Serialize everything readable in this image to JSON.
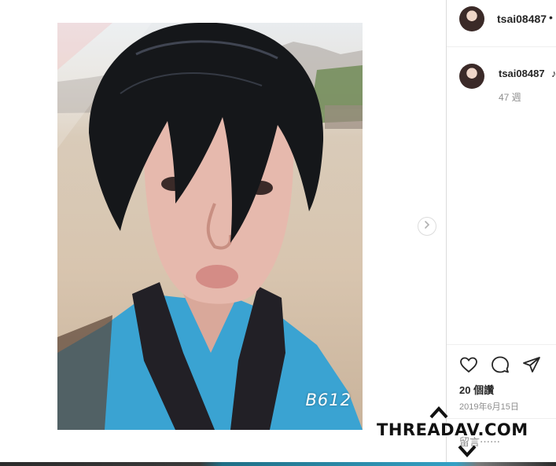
{
  "post": {
    "photo_label": "B612",
    "next_icon": "chevron-right-icon"
  },
  "sidebar": {
    "username": "tsai08487",
    "dot": "•",
    "comment": {
      "username": "tsai08487",
      "text_fragment": "♪",
      "time": "47 週"
    },
    "actions": [
      "heart-icon",
      "comment-icon",
      "share-icon"
    ],
    "likes": "20 個讚",
    "date": "2019年6月15日",
    "comment_placeholder": "留言⋯⋯"
  },
  "watermark": {
    "text": "THREADAV.COM"
  },
  "colors": {
    "divider": "#dbdbdb",
    "secondary_text": "#8e8e8e",
    "primary_text": "#262626",
    "shirt_blue": "#3aa3d2"
  }
}
